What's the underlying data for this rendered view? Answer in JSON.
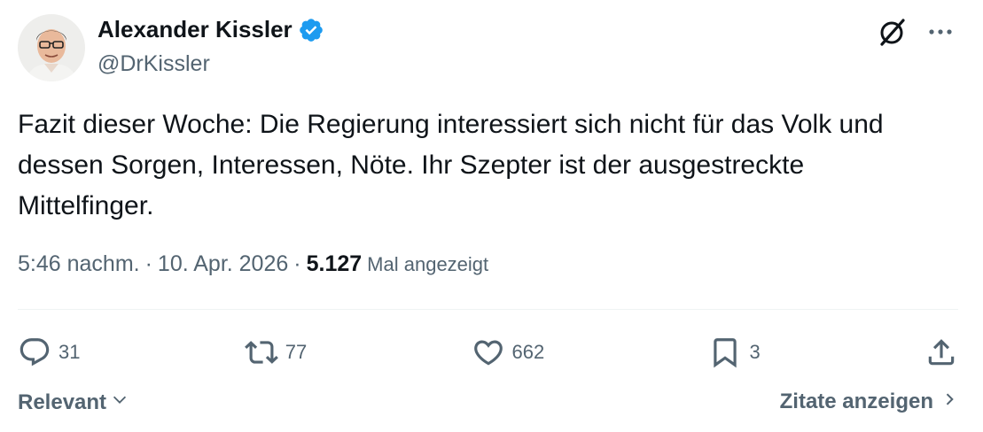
{
  "author": {
    "name": "Alexander Kissler",
    "handle": "@DrKissler"
  },
  "tweet": {
    "text": "Fazit dieser Woche: Die Regierung interessiert sich nicht für das Volk und\ndessen Sorgen, Interessen, Nöte. Ihr Szepter ist der ausgestreckte\nMittelfinger."
  },
  "meta": {
    "time": "5:46 nachm.",
    "sep1": "·",
    "date": "10. Apr. 2026",
    "sep2": "·",
    "views_count": "5.127",
    "views_label": "Mal angezeigt"
  },
  "actions": {
    "replies": "31",
    "reposts": "77",
    "likes": "662",
    "bookmarks": "3"
  },
  "footer": {
    "sort_label": "Relevant",
    "quotes_label": "Zitate anzeigen"
  },
  "icons": {
    "verified": "verified-badge-icon",
    "grok": "grok-icon",
    "more": "more-icon",
    "reply": "reply-icon",
    "repost": "repost-icon",
    "like": "like-icon",
    "bookmark": "bookmark-icon",
    "share": "share-icon"
  },
  "colors": {
    "text": "#0f1419",
    "secondary": "#536471",
    "verified": "#1d9bf0",
    "divider": "#eff3f4"
  }
}
